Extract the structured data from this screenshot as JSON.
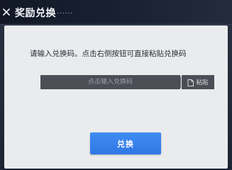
{
  "header": {
    "title": "奖励兑换",
    "dots": "......",
    "back_icon": "back-icon"
  },
  "dialog": {
    "prompt": "请输入兑换码。点击右侧按钮可直接粘贴兑换码",
    "code_input": {
      "value": "",
      "placeholder": "点击输入兑换码"
    },
    "paste_button": {
      "label": "粘贴",
      "icon": "document-icon"
    },
    "confirm_button": {
      "label": "兑换"
    }
  },
  "colors": {
    "accent": "#3584ee",
    "panel": "#eaebec",
    "input_bg": "#4b4e55"
  }
}
